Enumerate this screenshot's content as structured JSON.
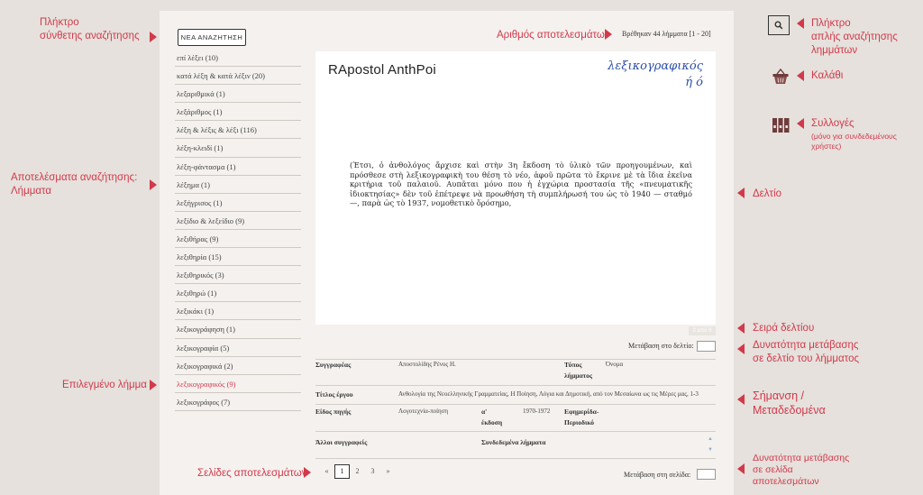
{
  "annotations": {
    "advanced_search_button": [
      "Πλήκτρο",
      "σύνθετης αναζήτησης"
    ],
    "results_count": "Αριθμός αποτελεσμάτων",
    "simple_search_button": [
      "Πλήκτρο",
      "απλής αναζήτησης",
      "λημμάτων"
    ],
    "cart": "Καλάθι",
    "collections": [
      "Συλλογές"
    ],
    "collections_note": [
      "(μόνο για συνδεδεμένους",
      "χρήστες)"
    ],
    "search_results": [
      "Αποτελέσματα αναζήτησης:",
      "Λήμματα"
    ],
    "card": "Δελτίο",
    "card_order": "Σειρά δελτίου",
    "goto_card": [
      "Δυνατότητα μετάβασης",
      "σε δελτίο του λήμματος"
    ],
    "selected_lemma": "Επιλεγμένο λήμμα",
    "tagging": [
      "Σήμανση /",
      "Μεταδεδομένα"
    ],
    "result_pages": "Σελίδες αποτελεσμάτων",
    "goto_page": [
      "Δυνατότητα μετάβασης",
      "σε σελίδα",
      "αποτελεσμάτων"
    ]
  },
  "new_search_label": "ΝΕΑ ΑΝΑΖΗΤΗΣΗ",
  "results_text": "Βρέθηκαν 44 λήμματα [1 - 20]",
  "lemmas": [
    "επί λέξει (10)",
    "κατά λέξη & κατά λέξιν (20)",
    "λεξαριθμικά (1)",
    "λεξάριθμος (1)",
    "λέξη & λέξις & λέξι (116)",
    "λέξη-κλειδί (1)",
    "λέξη-φάντασμα (1)",
    "λέξημα (1)",
    "λεξήγρισος (1)",
    "λεξίδιο & λεξείδιο (9)",
    "λεξιθήρας (9)",
    "λεξιθηρία (15)",
    "λεξιθηρικός (3)",
    "λεξιθηρώ (1)",
    "λεξικάκι (1)",
    "λεξικογράφηση (1)",
    "λεξικογραφία (5)",
    "λεξικογραφικά (2)",
    "λεξικογραφικός (9)",
    "λεξικογράφος (7)"
  ],
  "selected_lemma_index": 18,
  "card": {
    "head_left": "RApostol AnthPoi",
    "head_right": "λεξικογραφικός\nή ό",
    "text": "(Έτσι, ὁ ἀνθολόγος ἄρχισε καὶ στὴν 3η ἔκδοση τὸ ὑλικὸ τῶν προηγουμένων, καὶ πρόσθεσε στὴ λεξικογραφικὴ του θέση τὸ νέο, ἀφοῦ πρῶτα τὸ ἔκρινε μὲ τὰ ἴδια ἐκεῖνα κριτήρια τοῦ παλαιοῦ. Αυπᾶται μόνο που ἡ ἐγχώρια προστασία τῆς «πνευματικῆς ἰδιοκτησίας» δὲν τοῦ ἐπέτρεψε νὰ προωθήση τὴ συμπλήρωσή του ὡς τὸ 1940 — σταθμό —, παρὰ ὡς τὸ 1937, νομοθετικὸ ὅρόσημο,"
  },
  "card_nav": "2 από 9",
  "goto_card_label": "Μετάβαση στο δελτίο:",
  "meta": {
    "author_label": "Συγγραφέας",
    "author_value": "Αποστολίδης Ρένος Η.",
    "type_label": [
      "Τύπος",
      "λήμματος"
    ],
    "type_value": "Όνομα",
    "title_label": "Τίτλος έργου",
    "title_value": "Ανθολογία της Νεοελληνικής Γραμματείας, Η Ποίηση, Λόγια και Δημοτική, από τον Μεσαίωνα ως τις Μέρες μας, 1-3",
    "source_label": "Είδος πηγής",
    "source_value": "Λογοτεχνία-ποίηση",
    "edition_label": [
      "α'",
      "έκδοση"
    ],
    "edition_value": "1970-1972",
    "newspaper_label": [
      "Εφημερίδα-",
      "Περιοδικό"
    ],
    "other_authors_label": "Άλλοι συγγραφείς",
    "related_label": "Συνδεδεμένα λήμματα"
  },
  "pagination": [
    "«",
    "1",
    "2",
    "3",
    "»"
  ],
  "active_page": "1",
  "goto_page_label": "Μετάβαση στη σελίδα:"
}
